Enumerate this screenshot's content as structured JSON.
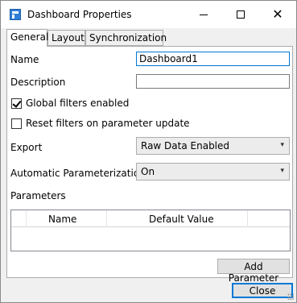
{
  "window": {
    "title": "Dashboard Properties",
    "close_glyph": "✕"
  },
  "tabs": [
    {
      "label": "General",
      "active": true
    },
    {
      "label": "Layout",
      "active": false
    },
    {
      "label": "Synchronization",
      "active": false
    }
  ],
  "general": {
    "name_label": "Name",
    "name_value": "Dashboard1",
    "description_label": "Description",
    "description_value": "",
    "global_filters_label": "Global filters enabled",
    "global_filters_checked": true,
    "reset_filters_label": "Reset filters on parameter update",
    "reset_filters_checked": false,
    "export_label": "Export",
    "export_value": "Raw Data Enabled",
    "auto_param_label": "Automatic Parameterization",
    "auto_param_value": "On",
    "parameters_label": "Parameters",
    "parameters_columns": [
      "Name",
      "Default Value"
    ],
    "parameters_rows": [],
    "add_parameter_label": "Add Parameter"
  },
  "footer": {
    "close_label": "Close"
  },
  "icons": {
    "app": "dashboard-icon",
    "chevron": "▾"
  },
  "colors": {
    "focus_border": "#0078d7",
    "panel_bg": "#ffffff",
    "window_bg": "#f0f0f0"
  }
}
